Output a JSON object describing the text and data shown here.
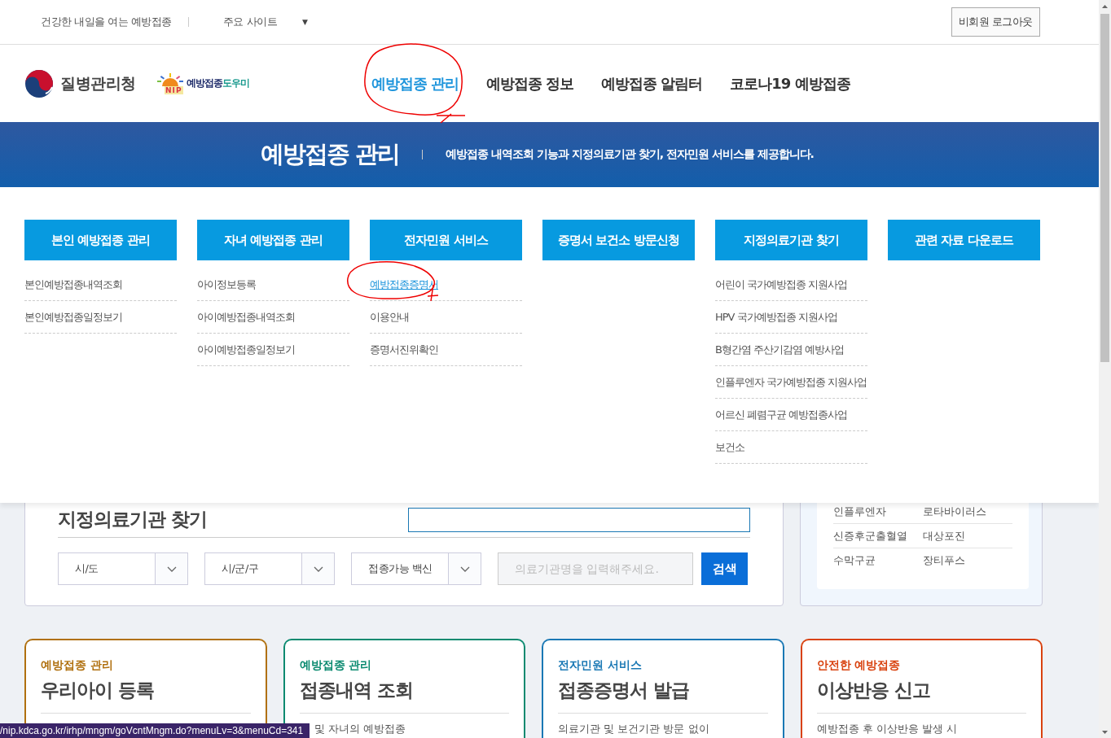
{
  "top_bar": {
    "slogan": "건강한 내일을 여는 예방접종",
    "sites_label": "주요 사이트",
    "sites_caret": "▼",
    "logout_button": "비회원 로그아웃"
  },
  "header": {
    "agency_name": "질병관리청",
    "nip_letters": "NIP",
    "helper_main": "예방접종",
    "helper_sub": "도우미",
    "nav": [
      {
        "label": "예방접종 관리",
        "selected": true
      },
      {
        "label": "예방접종 정보",
        "selected": false
      },
      {
        "label": "예방접종 알림터",
        "selected": false
      },
      {
        "label": "코로나19 예방접종",
        "selected": false
      }
    ]
  },
  "banner": {
    "title": "예방접종 관리",
    "description": "예방접종 내역조회 기능과 지정의료기관 찾기, 전자민원 서비스를 제공합니다."
  },
  "mega_menu": [
    {
      "heading": "본인 예방접종 관리",
      "items": [
        {
          "label": "본인예방접종내역조회",
          "selected": false
        },
        {
          "label": "본인예방접종일정보기",
          "selected": false
        }
      ]
    },
    {
      "heading": "자녀 예방접종 관리",
      "items": [
        {
          "label": "아이정보등록",
          "selected": false
        },
        {
          "label": "아이예방접종내역조회",
          "selected": false
        },
        {
          "label": "아이예방접종일정보기",
          "selected": false
        }
      ]
    },
    {
      "heading": "전자민원 서비스",
      "items": [
        {
          "label": "예방접종증명서",
          "selected": true
        },
        {
          "label": "이용안내",
          "selected": false
        },
        {
          "label": "증명서진위확인",
          "selected": false
        }
      ]
    },
    {
      "heading": "증명서 보건소 방문신청"
    },
    {
      "heading": "지정의료기관 찾기",
      "items": [
        {
          "label": "어린이 국가예방접종 지원사업",
          "selected": false
        },
        {
          "label": "HPV 국가예방접종 지원사업",
          "selected": false
        },
        {
          "label": "B형간염 주산기감염 예방사업",
          "selected": false
        },
        {
          "label": "인플루엔자 국가예방접종 지원사업",
          "selected": false
        },
        {
          "label": "어르신 폐렴구균 예방접종사업",
          "selected": false
        },
        {
          "label": "보건소",
          "selected": false
        }
      ]
    },
    {
      "heading": "관련 자료 다운로드"
    }
  ],
  "clinic_search": {
    "title": "지정의료기관 찾기",
    "selects": [
      "시/도",
      "시/군/구",
      "접종가능 백신"
    ],
    "name_placeholder": "의료기관명을 입력해주세요.",
    "search_button": "검색"
  },
  "diseases": [
    [
      "인플루엔자",
      "로타바이러스"
    ],
    [
      "신증후군출혈열",
      "대상포진"
    ],
    [
      "수막구균",
      "장티푸스"
    ]
  ],
  "cards": [
    {
      "category": "예방접종 관리",
      "title": "우리아이 등록",
      "color": "#b0700f"
    },
    {
      "category": "예방접종 관리",
      "title": "접종내역 조회",
      "description": "및 자녀의 예방접종",
      "color": "#0b8a70"
    },
    {
      "category": "전자민원 서비스",
      "title": "접종증명서 발급",
      "description": "의료기관 및 보건기관 방문 없이",
      "color": "#1a78b4"
    },
    {
      "category": "안전한 예방접종",
      "title": "이상반응 신고",
      "description": "예방접종 후 이상반응 발생 시",
      "color": "#d9420f"
    }
  ],
  "status_url": "/nip.kdca.go.kr/irhp/mngm/goVcntMngm.do?menuLv=3&menuCd=341"
}
